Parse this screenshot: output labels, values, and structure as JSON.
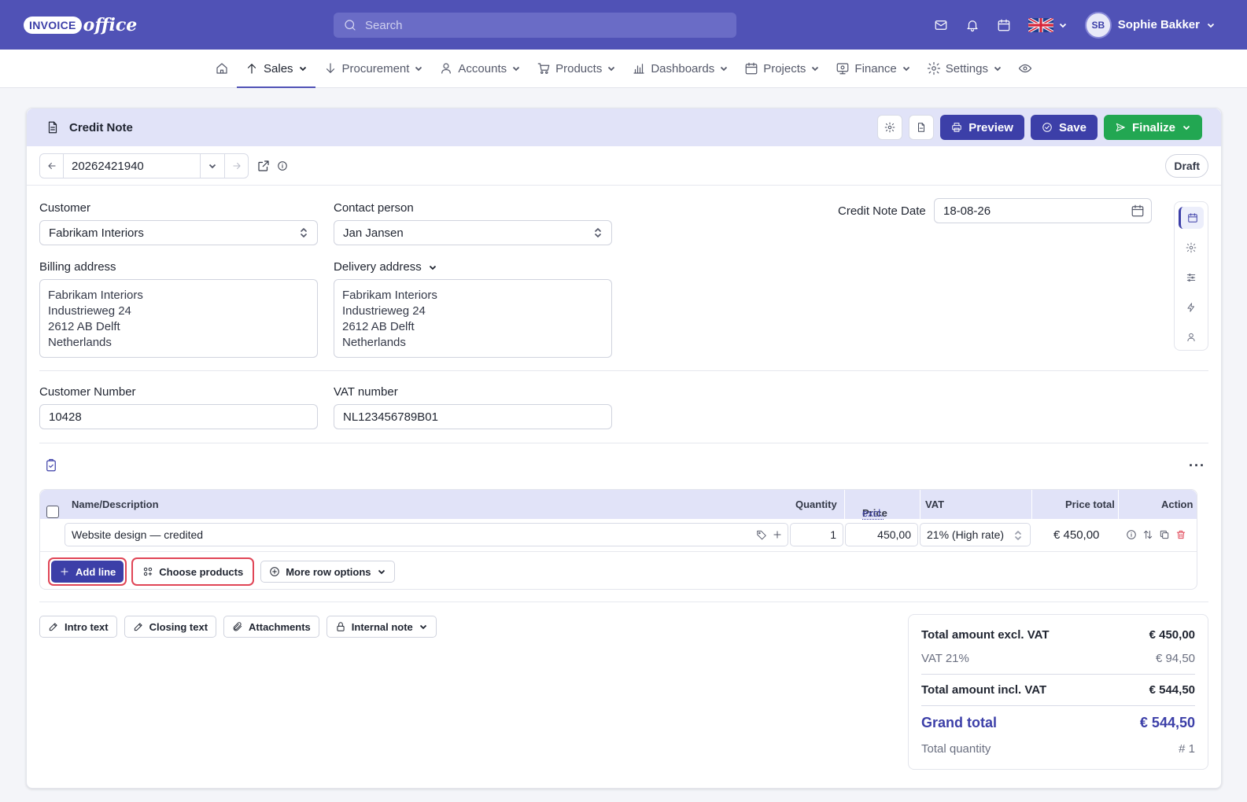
{
  "app": {
    "logo_pill": "INVOICE",
    "logo_office": "office",
    "search_placeholder": "Search",
    "user_initials": "SB",
    "user_name": "Sophie Bakker"
  },
  "nav": {
    "items": [
      {
        "label": "Sales"
      },
      {
        "label": "Procurement"
      },
      {
        "label": "Accounts"
      },
      {
        "label": "Products"
      },
      {
        "label": "Dashboards"
      },
      {
        "label": "Projects"
      },
      {
        "label": "Finance"
      },
      {
        "label": "Settings"
      }
    ]
  },
  "doc": {
    "title": "Credit Note",
    "preview_label": "Preview",
    "save_label": "Save",
    "finalize_label": "Finalize",
    "number": "20262421940",
    "status": "Draft"
  },
  "form": {
    "customer_label": "Customer",
    "customer_value": "Fabrikam Interiors",
    "contact_label": "Contact person",
    "contact_value": "Jan Jansen",
    "date_label": "Credit Note Date",
    "date_value": "18-08-26",
    "billing_label": "Billing address",
    "billing_lines": [
      "Fabrikam Interiors",
      "Industrieweg 24",
      "2612 AB Delft",
      "Netherlands"
    ],
    "delivery_label": "Delivery address",
    "delivery_lines": [
      "Fabrikam Interiors",
      "Industrieweg 24",
      "2612 AB Delft",
      "Netherlands"
    ],
    "customer_number_label": "Customer Number",
    "customer_number_value": "10428",
    "vat_label": "VAT number",
    "vat_value": "NL123456789B01"
  },
  "lines": {
    "columns": {
      "name": "Name/Description",
      "quantity": "Quantity",
      "price": "Price",
      "price_suffix": "excl.",
      "vat": "VAT",
      "price_total": "Price total",
      "action": "Action"
    },
    "rows": [
      {
        "description": "Website design — credited",
        "quantity": "1",
        "price": "450,00",
        "vat": "21% (High rate)",
        "total": "€ 450,00"
      }
    ],
    "add_line_label": "Add line",
    "choose_products_label": "Choose products",
    "more_options_label": "More row options"
  },
  "footer_buttons": {
    "intro": "Intro text",
    "closing": "Closing text",
    "attachments": "Attachments",
    "internal_note": "Internal note"
  },
  "totals": {
    "excl_label": "Total amount excl. VAT",
    "excl_value": "€ 450,00",
    "vat_label": "VAT 21%",
    "vat_value": "€ 94,50",
    "incl_label": "Total amount incl. VAT",
    "incl_value": "€ 544,50",
    "grand_label": "Grand total",
    "grand_value": "€ 544,50",
    "qty_label": "Total quantity",
    "qty_value": "# 1"
  }
}
